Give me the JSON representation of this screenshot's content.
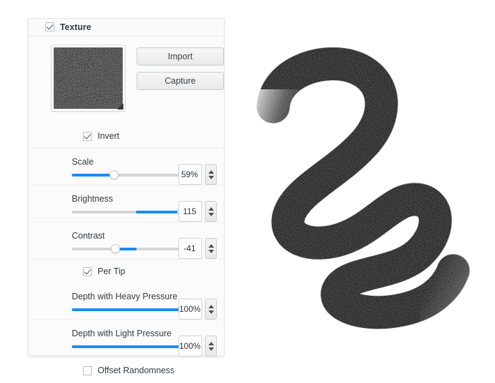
{
  "panel": {
    "header": {
      "label": "Texture",
      "checked": true,
      "checkbox_name": "texture-enable-checkbox"
    },
    "thumbnail": {
      "name": "texture-preview-thumbnail",
      "corner_handle": "thumbnail-corner-indicator"
    },
    "buttons": [
      {
        "label": "Import",
        "name": "import-button"
      },
      {
        "label": "Capture",
        "name": "capture-button"
      }
    ],
    "invert": {
      "label": "Invert",
      "checked": true
    },
    "sliders": [
      {
        "label": "Scale",
        "value": "59%",
        "name": "scale",
        "fill_mode": "left",
        "percent": 33
      },
      {
        "label": "Brightness",
        "value": "115",
        "name": "brightness",
        "fill_mode": "center",
        "percent": 86
      },
      {
        "label": "Contrast",
        "value": "-41",
        "name": "contrast",
        "fill_mode": "center",
        "percent": 34
      }
    ],
    "per_tip": {
      "label": "Per Tip",
      "checked": true
    },
    "depth_sliders": [
      {
        "label": "Depth with Heavy Pressure",
        "value": "100%",
        "name": "depth-heavy-pressure",
        "fill_mode": "left",
        "percent": 96
      },
      {
        "label": "Depth with Light Pressure",
        "value": "100%",
        "name": "depth-light-pressure",
        "fill_mode": "left",
        "percent": 96
      }
    ],
    "offset_randomness": {
      "label": "Offset Randomness",
      "checked": false
    },
    "spinner": {
      "up_icon": "triangle-up-icon",
      "down_icon": "triangle-down-icon"
    }
  },
  "preview": {
    "name": "brush-stroke-preview",
    "description": "Textured black S-shaped brush stroke"
  },
  "colors": {
    "accent": "#1a8cf0",
    "track": "#d5d5d5",
    "panel_bg": "#fbfbfb",
    "text": "#343b43",
    "stroke": "#1d1d1d"
  }
}
